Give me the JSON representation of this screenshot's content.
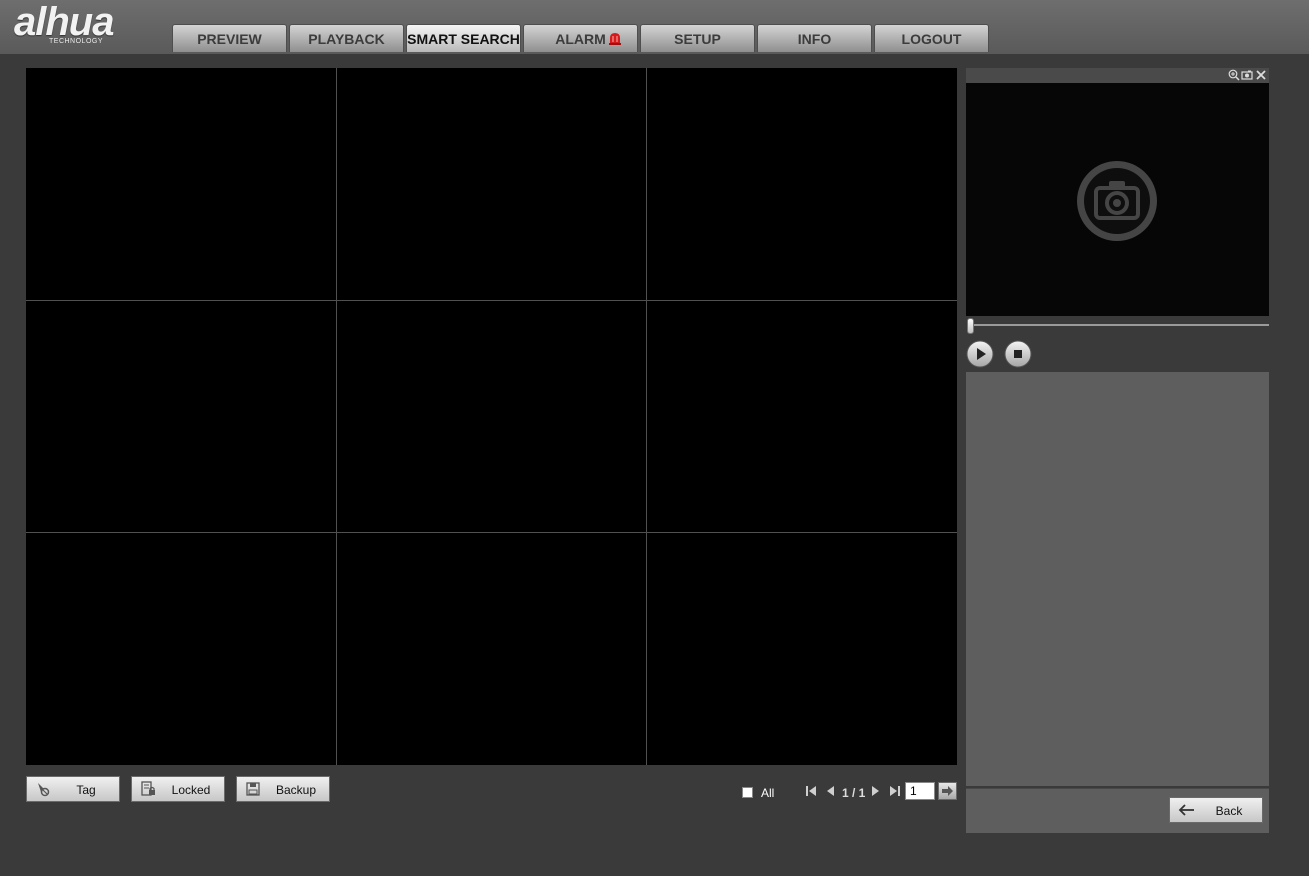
{
  "brand": {
    "logo_text": "alhua",
    "logo_sub": "TECHNOLOGY"
  },
  "nav": {
    "tabs": [
      {
        "label": "PREVIEW"
      },
      {
        "label": "PLAYBACK"
      },
      {
        "label": "SMART SEARCH"
      },
      {
        "label": "ALARM"
      },
      {
        "label": "SETUP"
      },
      {
        "label": "INFO"
      },
      {
        "label": "LOGOUT"
      }
    ],
    "active": "SMART SEARCH"
  },
  "toolbar": {
    "tag_label": "Tag",
    "locked_label": "Locked",
    "backup_label": "Backup"
  },
  "pager": {
    "all_label": "All",
    "page_text": "1 / 1",
    "page_input": "1"
  },
  "panel": {
    "back_label": "Back"
  },
  "colors": {
    "alarm": "#d41c1c"
  }
}
